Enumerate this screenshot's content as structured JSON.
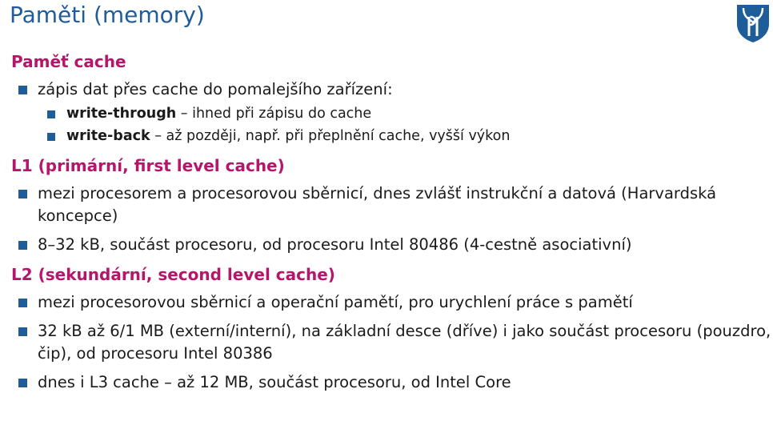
{
  "title": "Paměti (memory)",
  "logo_icon": "university-shield-logo",
  "colors": {
    "title": "#1f5c9a",
    "heading": "#b5166b",
    "bullet": "#1f5c9a"
  },
  "sections": [
    {
      "heading": "Paměť cache",
      "items": [
        {
          "text": "zápis dat přes cache do pomalejšího zařízení:",
          "subitems": [
            {
              "term": "write-through",
              "text": " – ihned při zápisu do cache"
            },
            {
              "term": "write-back",
              "text": " – až později, např. při přeplnění cache, vyšší výkon"
            }
          ]
        }
      ]
    },
    {
      "heading": "L1 (primární, first level cache)",
      "items": [
        {
          "text": "mezi procesorem a procesorovou sběrnicí, dnes zvlášť instrukční a datová (Harvardská koncepce)"
        },
        {
          "text": "8–32 kB, součást procesoru, od procesoru Intel 80486 (4-cestně asociativní)"
        }
      ]
    },
    {
      "heading": "L2 (sekundární, second level cache)",
      "items": [
        {
          "text": "mezi procesorovou sběrnicí a operační pamětí, pro urychlení práce s pamětí"
        },
        {
          "text": "32 kB až 6/1 MB (externí/interní), na základní desce (dříve) i jako součást procesoru (pouzdro, čip), od procesoru Intel 80386"
        },
        {
          "text": "dnes i L3 cache – až 12 MB, součást procesoru, od Intel Core"
        }
      ]
    }
  ]
}
